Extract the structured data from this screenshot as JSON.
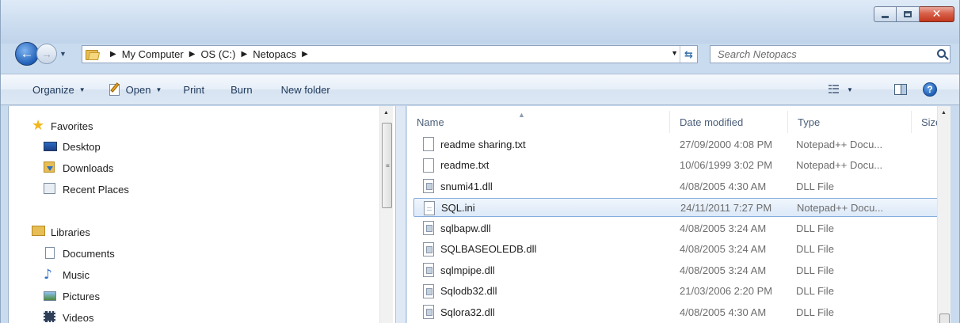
{
  "breadcrumb": [
    "My Computer",
    "OS (C:)",
    "Netopacs"
  ],
  "search": {
    "placeholder": "Search Netopacs"
  },
  "toolbar": {
    "organize": "Organize",
    "open": "Open",
    "print": "Print",
    "burn": "Burn",
    "new_folder": "New folder"
  },
  "nav": {
    "favorites": {
      "label": "Favorites",
      "items": [
        "Desktop",
        "Downloads",
        "Recent Places"
      ]
    },
    "libraries": {
      "label": "Libraries",
      "items": [
        "Documents",
        "Music",
        "Pictures",
        "Videos"
      ]
    }
  },
  "columns": {
    "name": "Name",
    "date": "Date modified",
    "type": "Type",
    "size": "Size"
  },
  "files": [
    {
      "name": "readme sharing.txt",
      "date": "27/09/2000 4:08 PM",
      "type": "Notepad++ Docu...",
      "icon": "text-file-icon"
    },
    {
      "name": "readme.txt",
      "date": "10/06/1999 3:02 PM",
      "type": "Notepad++ Docu...",
      "icon": "text-file-icon"
    },
    {
      "name": "snumi41.dll",
      "date": "4/08/2005 4:30 AM",
      "type": "DLL File",
      "icon": "dll-file-icon"
    },
    {
      "name": "SQL.ini",
      "date": "24/11/2011 7:27 PM",
      "type": "Notepad++ Docu...",
      "icon": "ini-file-icon",
      "selected": true
    },
    {
      "name": "sqlbapw.dll",
      "date": "4/08/2005 3:24 AM",
      "type": "DLL File",
      "icon": "dll-file-icon"
    },
    {
      "name": "SQLBASEOLEDB.dll",
      "date": "4/08/2005 3:24 AM",
      "type": "DLL File",
      "icon": "dll-file-icon"
    },
    {
      "name": "sqlmpipe.dll",
      "date": "4/08/2005 3:24 AM",
      "type": "DLL File",
      "icon": "dll-file-icon"
    },
    {
      "name": "Sqlodb32.dll",
      "date": "21/03/2006 2:20 PM",
      "type": "DLL File",
      "icon": "dll-file-icon"
    },
    {
      "name": "Sqlora32.dll",
      "date": "4/08/2005 4:30 AM",
      "type": "DLL File",
      "icon": "dll-file-icon"
    }
  ]
}
